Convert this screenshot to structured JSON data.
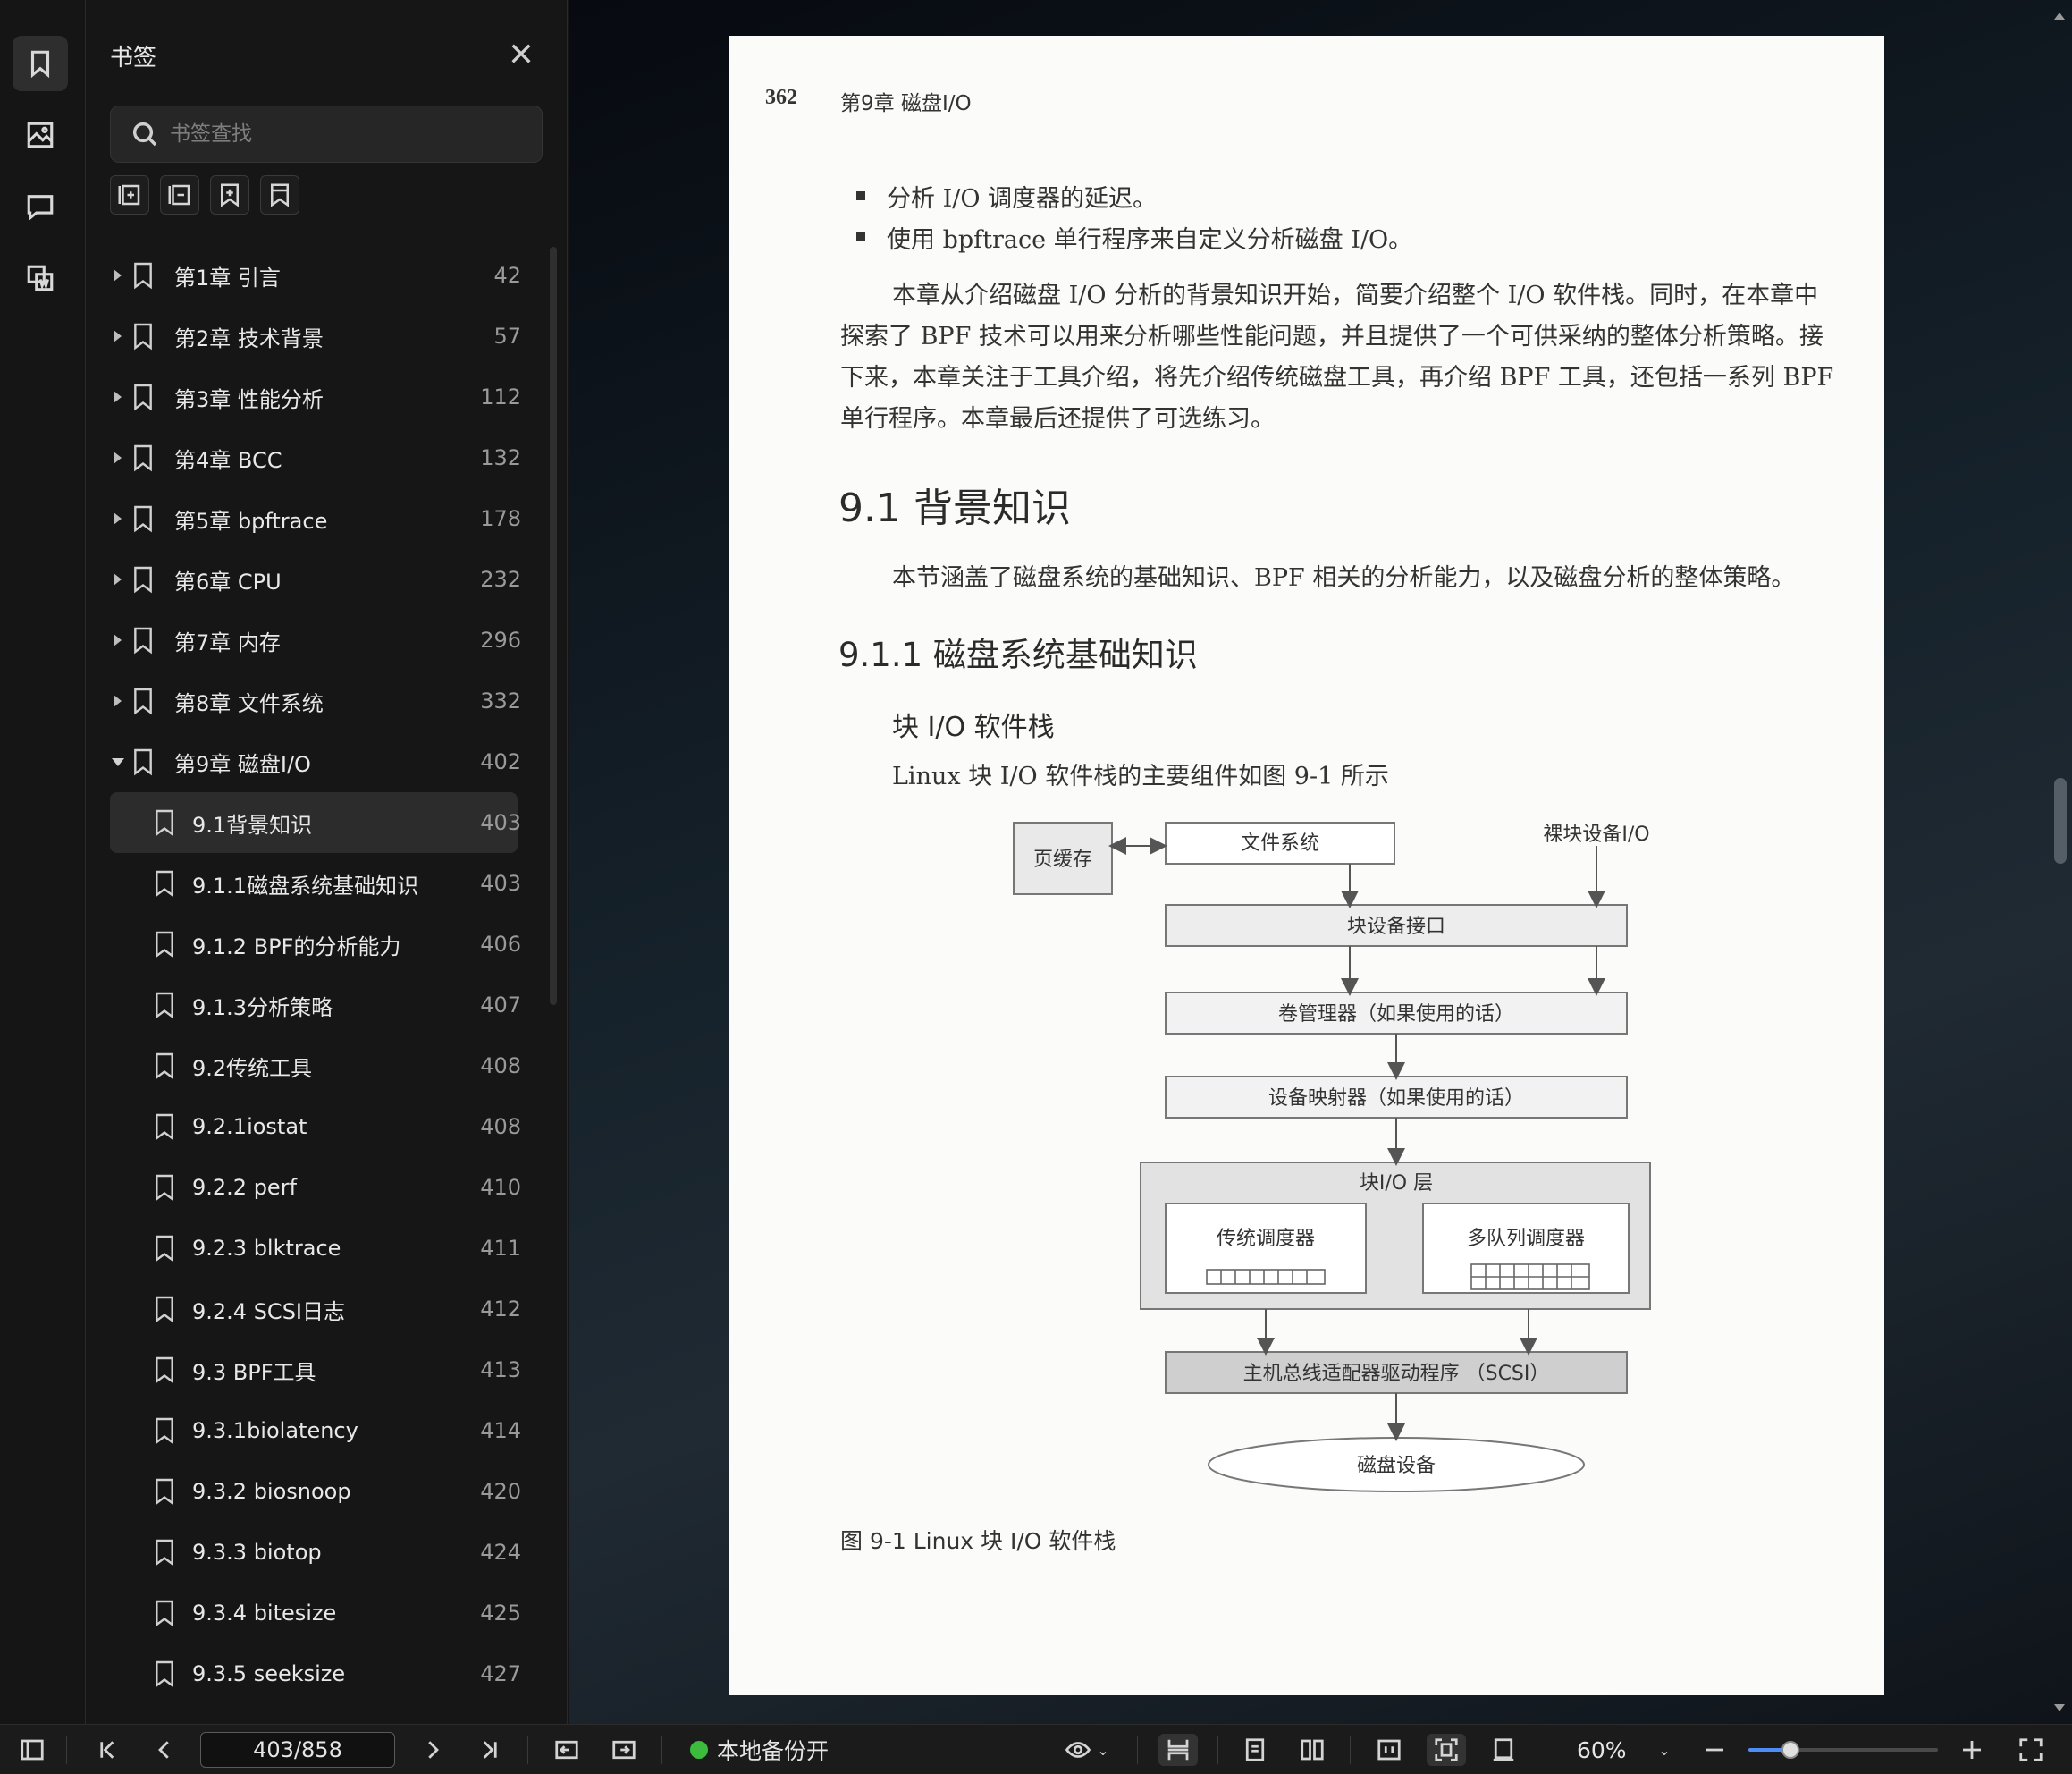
{
  "sidebar": {
    "title": "书签",
    "search_placeholder": "书签查找",
    "bookmarks": [
      {
        "label": "第1章  引言",
        "page": "42",
        "level": 0,
        "expanded": false
      },
      {
        "label": "第2章  技术背景",
        "page": "57",
        "level": 0,
        "expanded": false
      },
      {
        "label": "第3章  性能分析",
        "page": "112",
        "level": 0,
        "expanded": false
      },
      {
        "label": "第4章  BCC",
        "page": "132",
        "level": 0,
        "expanded": false
      },
      {
        "label": "第5章  bpftrace",
        "page": "178",
        "level": 0,
        "expanded": false
      },
      {
        "label": "第6章  CPU",
        "page": "232",
        "level": 0,
        "expanded": false
      },
      {
        "label": "第7章  内存",
        "page": "296",
        "level": 0,
        "expanded": false
      },
      {
        "label": "第8章  文件系统",
        "page": "332",
        "level": 0,
        "expanded": false
      },
      {
        "label": "第9章  磁盘I/O",
        "page": "402",
        "level": 0,
        "expanded": true
      },
      {
        "label": "9.1背景知识",
        "page": "403",
        "level": 1,
        "selected": true
      },
      {
        "label": "9.1.1磁盘系统基础知识",
        "page": "403",
        "level": 1
      },
      {
        "label": "9.1.2  BPF的分析能力",
        "page": "406",
        "level": 1
      },
      {
        "label": "9.1.3分析策略",
        "page": "407",
        "level": 1
      },
      {
        "label": "9.2传统工具",
        "page": "408",
        "level": 1
      },
      {
        "label": "9.2.1iostat",
        "page": "408",
        "level": 1
      },
      {
        "label": "9.2.2 perf",
        "page": "410",
        "level": 1
      },
      {
        "label": "9.2.3  blktrace",
        "page": "411",
        "level": 1
      },
      {
        "label": "9.2.4  SCSI日志",
        "page": "412",
        "level": 1
      },
      {
        "label": "9.3  BPF工具",
        "page": "413",
        "level": 1
      },
      {
        "label": "9.3.1biolatency",
        "page": "414",
        "level": 1
      },
      {
        "label": "9.3.2 biosnoop",
        "page": "420",
        "level": 1
      },
      {
        "label": "9.3.3  biotop",
        "page": "424",
        "level": 1
      },
      {
        "label": "9.3.4  bitesize",
        "page": "425",
        "level": 1
      },
      {
        "label": "9.3.5  seeksize",
        "page": "427",
        "level": 1
      }
    ]
  },
  "document": {
    "page_number": "362",
    "running_header": "第9章    磁盘I/O",
    "bullets": [
      "分析 I/O 调度器的延迟。",
      "使用 bpftrace 单行程序来自定义分析磁盘 I/O。"
    ],
    "intro_paragraph": "本章从介绍磁盘 I/O 分析的背景知识开始，简要介绍整个 I/O 软件栈。同时，在本章中探索了 BPF 技术可以用来分析哪些性能问题，并且提供了一个可供采纳的整体分析策略。接下来，本章关注于工具介绍，将先介绍传统磁盘工具，再介绍 BPF 工具，还包括一系列 BPF 单行程序。本章最后还提供了可选练习。",
    "section_title": "9.1   背景知识",
    "section_text": "本节涵盖了磁盘系统的基础知识、BPF 相关的分析能力，以及磁盘分析的整体策略。",
    "subsection_title": "9.1.1   磁盘系统基础知识",
    "subsubsection_title": "块 I/O 软件栈",
    "figure_intro": "Linux 块 I/O 软件栈的主要组件如图 9-1 所示",
    "figure_caption": "图 9-1    Linux 块 I/O 软件栈",
    "diagram": {
      "page_cache": "页缓存",
      "file_system": "文件系统",
      "raw_block": "裸块设备I/O",
      "block_interface": "块设备接口",
      "volume_manager": "卷管理器（如果使用的话）",
      "device_mapper": "设备映射器（如果使用的话）",
      "block_layer": "块I/O 层",
      "classic_scheduler": "传统调度器",
      "multiqueue_scheduler": "多队列调度器",
      "hba_driver": "主机总线适配器驱动程序 （SCSI）",
      "disk_device": "磁盘设备"
    }
  },
  "statusbar": {
    "page_field": "403/858",
    "backup_label": "本地备份开",
    "zoom": "60%",
    "zoom_slider_fraction": 0.22
  }
}
